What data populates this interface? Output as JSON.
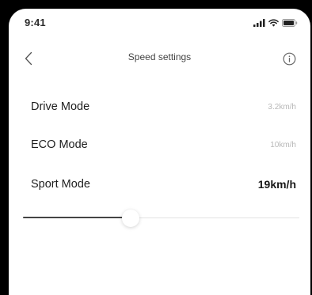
{
  "status_bar": {
    "time": "9:41",
    "icons": [
      "cellular-signal-icon",
      "wifi-icon",
      "battery-icon"
    ]
  },
  "nav": {
    "back_icon": "chevron-left-icon",
    "title": "Speed settings",
    "info_icon": "info-circle-icon"
  },
  "modes": [
    {
      "label": "Drive Mode",
      "value": "3.2km/h",
      "active": false
    },
    {
      "label": "ECO Mode",
      "value": "10km/h",
      "active": false
    },
    {
      "label": "Sport Mode",
      "value": "19km/h",
      "active": true
    }
  ],
  "slider": {
    "level": 0.39,
    "fill_color": "#444444",
    "track_color": "#e3e3e3"
  },
  "colors": {
    "background": "#ffffff",
    "frame": "#000000",
    "text_primary": "#1e1e1e",
    "text_muted": "#b8b8b8"
  }
}
